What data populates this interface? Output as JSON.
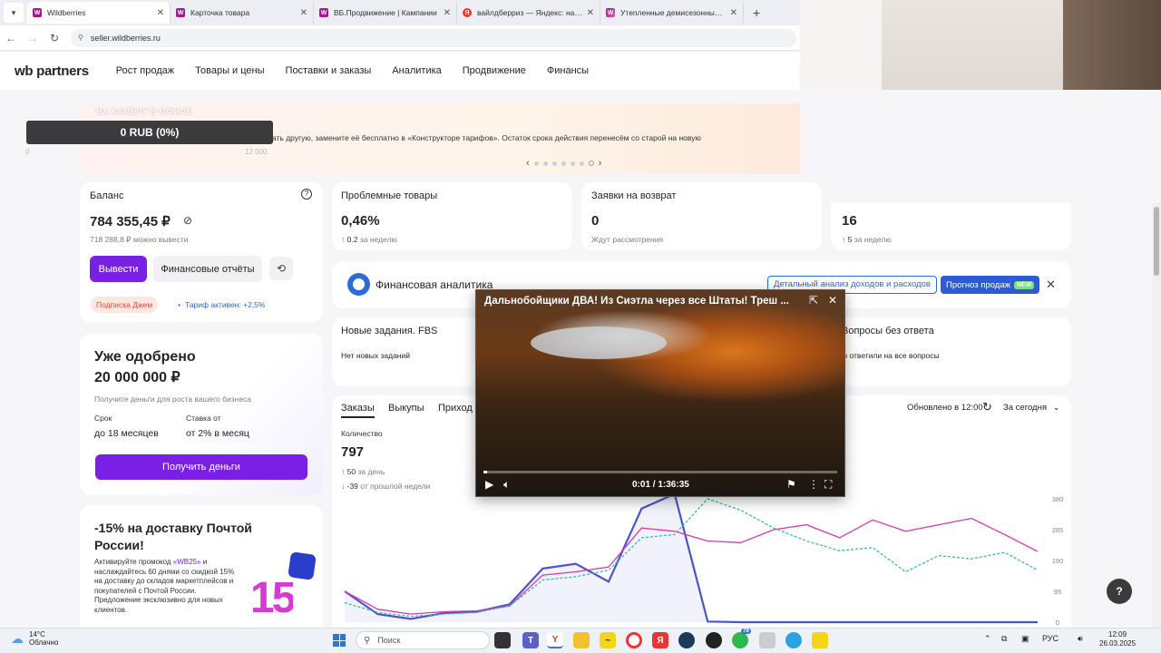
{
  "browser": {
    "tabs": [
      {
        "label": "Wildberries",
        "favicon": "W",
        "active": true
      },
      {
        "label": "Карточка товара",
        "favicon": "W",
        "active": false
      },
      {
        "label": "ВБ.Продвижение | Кампании",
        "favicon": "W",
        "active": false
      },
      {
        "label": "вайлдберриз — Яндекс: нашл",
        "favicon": "Я",
        "active": false
      },
      {
        "label": "Утепленные демисезонные кр",
        "favicon": "W",
        "active": false
      }
    ],
    "url": "seller.wildberries.ru"
  },
  "header": {
    "logo_wb": "wb",
    "logo_partners": "partners",
    "nav": [
      "Рост продаж",
      "Товары и цены",
      "Поставки и заказы",
      "Аналитика",
      "Продвижение",
      "Финансы"
    ]
  },
  "banner": {
    "tag": "НА КАМЕРУ В ОФИСЕ",
    "text": "ать другую, замените её бесплатно в «Конструкторе тарифов». Остаток срока действия перенесём со старой на новую",
    "rub_badge": "0 RUB (0%)",
    "rub_min": "0",
    "rub_max": "12 000"
  },
  "balance": {
    "title": "Баланс",
    "value": "784 355,45 ₽",
    "sub": "718 288,8 ₽ можно вывести",
    "withdraw_btn": "Вывести",
    "reports_btn": "Финансовые отчёты",
    "subscription": "Подписка Джем",
    "tariff": "Тариф активен: +2,5%"
  },
  "problem_goods": {
    "title": "Проблемные товары",
    "value": "0,46%",
    "delta": "0.2",
    "delta_suffix": "за неделю"
  },
  "returns": {
    "title": "Заявки на возврат",
    "value": "0",
    "sub": "Ждут рассмотрения"
  },
  "fourth_card": {
    "value": "16",
    "delta": "5",
    "delta_suffix": "за неделю"
  },
  "loan": {
    "title_line1": "Уже одобрено",
    "title_line2": "20 000 000 ₽",
    "desc": "Получите деньги для роста вашего бизнеса",
    "term_label": "Срок",
    "term_value": "до 18 месяцев",
    "rate_label": "Ставка от",
    "rate_value": "от 2% в месяц",
    "button": "Получить деньги"
  },
  "fin_analytics": {
    "title": "Финансовая аналитика",
    "link": "Детальный анализ доходов и расходов",
    "forecast_btn": "Прогноз продаж",
    "new_badge": "NEW"
  },
  "fbs": {
    "title": "Новые задания. FBS",
    "sub": "Нет новых заданий"
  },
  "questions": {
    "title": "Вопросы без ответа",
    "sub": "ы ответили на все вопросы"
  },
  "orders": {
    "tabs": [
      "Заказы",
      "Выкупы",
      "Приход"
    ],
    "updated": "Обновлено в 12:00",
    "period": "За сегодня",
    "qty_label": "Количество",
    "qty_value": "797",
    "day_delta": "50",
    "day_suffix": "за день",
    "week_delta": "-39",
    "week_suffix": "от прошлой недели"
  },
  "promo": {
    "title_line1": "-15% на доставку Почтой",
    "title_line2": "России!",
    "body_before": "Активируйте промокод ",
    "code": "«WB25»",
    "body_after": " и наслаждайтесь 60 днями со скидкой 15% на доставку до складов маркетплейсов и покупателей с Почтой России. Предложение эксклюзивно для новых клиентов.",
    "badge": "15"
  },
  "video": {
    "title": "Дальнобойщики ДВА! Из Сиэтла через все Штаты! Треш ...",
    "time": "0:01 / 1:36:35",
    "progress": 0.01
  },
  "chart_data": {
    "type": "line",
    "y_ticks": [
      "380",
      "285",
      "190",
      "95",
      "0"
    ],
    "ylim": [
      0,
      380
    ],
    "series": [
      {
        "color": "#4a55c8",
        "style": "solid-area",
        "values": [
          95,
          25,
          10,
          28,
          32,
          55,
          165,
          180,
          125,
          350,
          395,
          2,
          0,
          0,
          0,
          0,
          0,
          0,
          0,
          0,
          0,
          0
        ]
      },
      {
        "color": "#d43bb0",
        "style": "solid",
        "values": [
          95,
          40,
          25,
          32,
          35,
          50,
          145,
          155,
          170,
          290,
          280,
          250,
          245,
          285,
          300,
          260,
          315,
          280,
          300,
          320,
          270,
          218
        ]
      },
      {
        "color": "#3fb7a8",
        "style": "dashed",
        "values": [
          60,
          30,
          18,
          25,
          30,
          50,
          130,
          140,
          160,
          260,
          270,
          380,
          345,
          290,
          250,
          220,
          230,
          155,
          205,
          195,
          215,
          160
        ]
      }
    ]
  },
  "taskbar": {
    "temp": "14°C",
    "weather": "Облачно",
    "search": "Поиск",
    "lang": "РУС",
    "time": "12:09",
    "date": "26.03.2025",
    "whatsapp_count": "78"
  },
  "help": "?"
}
